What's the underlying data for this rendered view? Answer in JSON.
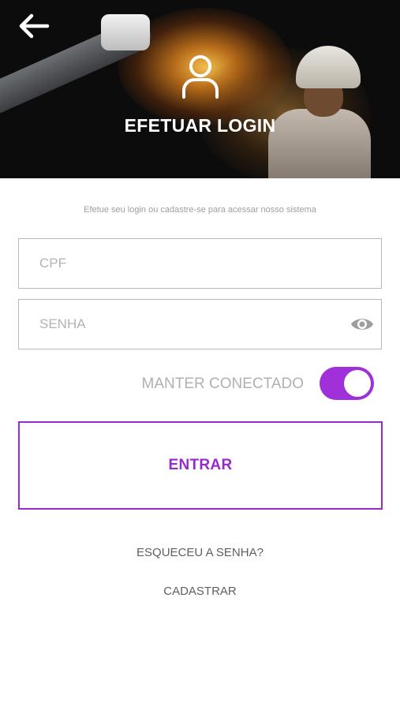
{
  "header": {
    "title": "EFETUAR LOGIN",
    "back_icon": "arrow-left-icon",
    "user_icon": "user-outline-icon"
  },
  "subtitle": "Efetue seu login ou cadastre-se para acessar nosso sistema",
  "form": {
    "cpf": {
      "placeholder": "CPF",
      "value": ""
    },
    "password": {
      "placeholder": "SENHA",
      "value": "",
      "toggle_icon": "eye-icon"
    },
    "remember": {
      "label": "MANTER CONECTADO",
      "checked": true
    }
  },
  "actions": {
    "submit_label": "ENTRAR",
    "forgot_label": "ESQUECEU A SENHA?",
    "register_label": "CADASTRAR"
  },
  "colors": {
    "accent": "#9a28cf",
    "toggle_on": "#a030d8",
    "placeholder": "#b3b3b3",
    "border": "#b9b9b9"
  }
}
